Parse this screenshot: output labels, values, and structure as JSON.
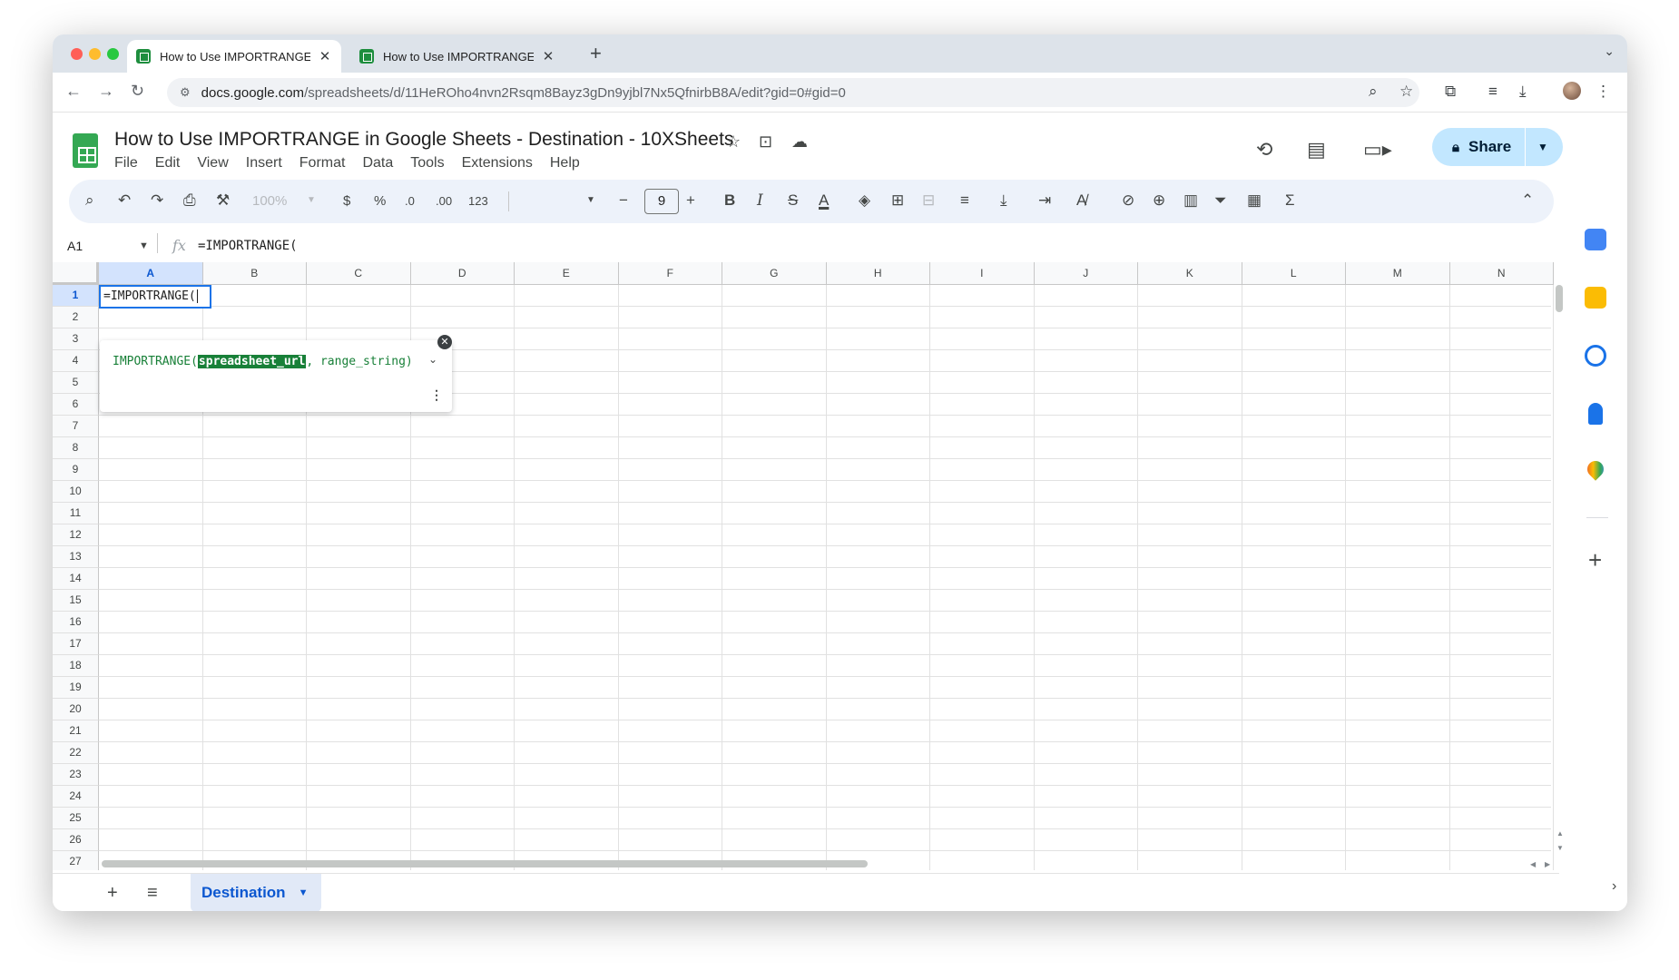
{
  "browser": {
    "tabs": [
      {
        "title": "How to Use IMPORTRANGE in",
        "active": true
      },
      {
        "title": "How to Use IMPORTRANGE in",
        "active": false
      }
    ],
    "url_host": "docs.google.com",
    "url_path": "/spreadsheets/d/11HeROho4nvn2Rsqm8Bayz3gDn9yjbl7Nx5QfnirbB8A/edit?gid=0#gid=0"
  },
  "doc": {
    "title": "How to Use IMPORTRANGE in Google Sheets - Destination - 10XSheets",
    "menu": [
      "File",
      "Edit",
      "View",
      "Insert",
      "Format",
      "Data",
      "Tools",
      "Extensions",
      "Help"
    ],
    "share_label": "Share"
  },
  "toolbar": {
    "zoom": "100%",
    "currency": "$",
    "percent": "%",
    "dec_decrease": ".0",
    "dec_increase": ".00",
    "number_format": "123",
    "font_size": "9"
  },
  "formula_bar": {
    "cell_ref": "A1",
    "formula": "=IMPORTRANGE("
  },
  "grid": {
    "columns": [
      "A",
      "B",
      "C",
      "D",
      "E",
      "F",
      "G",
      "H",
      "I",
      "J",
      "K",
      "L",
      "M",
      "N"
    ],
    "rows": [
      "1",
      "2",
      "3",
      "4",
      "5",
      "6",
      "7",
      "8",
      "9",
      "10",
      "11",
      "12",
      "13",
      "14",
      "15",
      "16",
      "17",
      "18",
      "19",
      "20",
      "21",
      "22",
      "23",
      "24",
      "25",
      "26",
      "27"
    ],
    "selected_column": "A",
    "selected_row": "1",
    "active_cell_text": "=IMPORTRANGE("
  },
  "autocomplete": {
    "func_name": "IMPORTRANGE(",
    "arg_active": "spreadsheet_url",
    "arg_rest": ", range_string)"
  },
  "sheet_tabs": [
    {
      "name": "Destination",
      "active": true
    }
  ],
  "colors": {
    "accent": "#0b57d0",
    "selection": "#1a73e8",
    "sheets_green": "#34a853",
    "share_bg": "#c2e7ff",
    "formula_green": "#188038"
  }
}
